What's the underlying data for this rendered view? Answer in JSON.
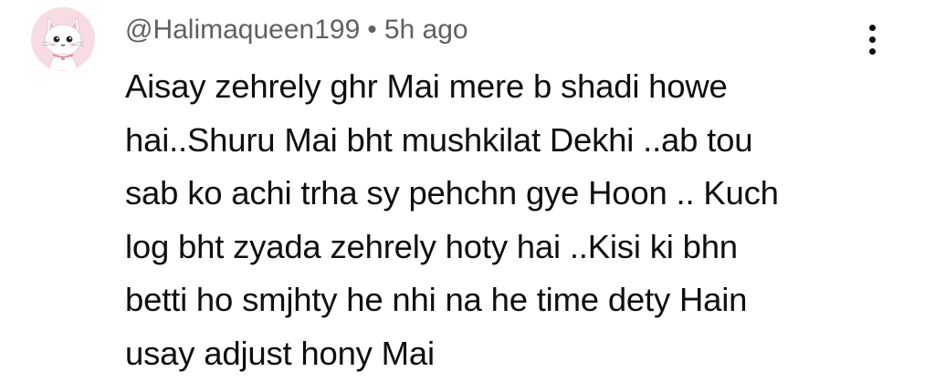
{
  "comment": {
    "author": "@Halimaqueen199",
    "separator": "•",
    "time": "5h ago",
    "text": "Aisay zehrely ghr Mai mere b shadi howe\nhai..Shuru Mai bht mushkilat Dekhi ..ab tou\nsab ko achi trha sy pehchn gye Hoon ..  Kuch\nlog bht zyada zehrely hoty hai ..Kisi ki bhn\nbetti ho smjhty he nhi na he time dety Hain\nusay adjust hony Mai",
    "avatar_icon": "cat-avatar-icon",
    "menu_icon": "more-vertical-icon"
  },
  "colors": {
    "avatar_bg": "#f7dde3",
    "meta_text": "#606060",
    "body_text": "#0f0f0f"
  }
}
